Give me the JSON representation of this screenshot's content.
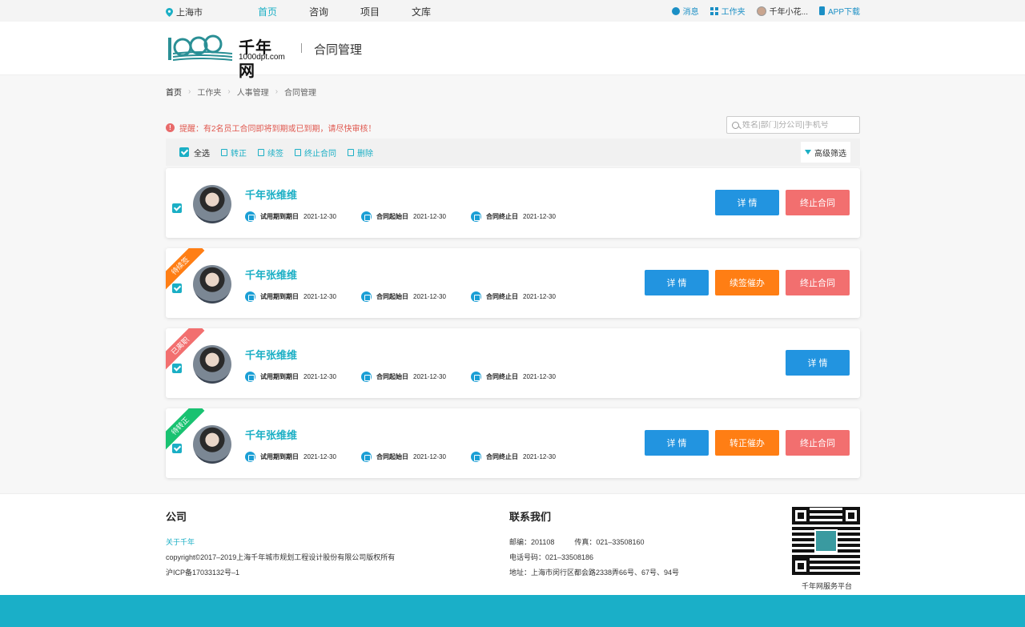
{
  "topbar": {
    "location": "上海市",
    "nav": [
      {
        "label": "首页",
        "active": true
      },
      {
        "label": "咨询",
        "active": false
      },
      {
        "label": "项目",
        "active": false
      },
      {
        "label": "文库",
        "active": false
      }
    ],
    "messages": "消息",
    "workspace": "工作夹",
    "user": "千年小花...",
    "app": "APP下载"
  },
  "header": {
    "brand": "千年网",
    "domain": "1000dpt.com",
    "page_title": "合同管理"
  },
  "breadcrumb": [
    "首页",
    "工作夹",
    "人事管理",
    "合同管理"
  ],
  "notice": "提醒：有2名员工合同即将到期或已到期，请尽快审核！",
  "search": {
    "placeholder": "姓名|部门|分公司|手机号"
  },
  "toolbar": {
    "select_all": "全选",
    "actions": [
      "转正",
      "续签",
      "终止合同",
      "删除"
    ],
    "advanced": "高级筛选"
  },
  "colors": {
    "accent": "#1bafc5",
    "blue": "#2294e0",
    "orange": "#ff7e14",
    "red": "#f26f6f",
    "green": "#19c271"
  },
  "labels": {
    "probation_end": "试用期到期日",
    "contract_start": "合同起始日",
    "contract_end": "合同终止日"
  },
  "cards": [
    {
      "name": "千年张维维",
      "ribbon": "",
      "ribbon_color": "",
      "probation_end": "2021-12-30",
      "contract_start": "2021-12-30",
      "contract_end": "2021-12-30",
      "buttons": [
        {
          "label": "详 情",
          "color": "blue"
        },
        {
          "label": "终止合同",
          "color": "red"
        }
      ]
    },
    {
      "name": "千年张维维",
      "ribbon": "待续签",
      "ribbon_color": "#ff7e14",
      "probation_end": "2021-12-30",
      "contract_start": "2021-12-30",
      "contract_end": "2021-12-30",
      "buttons": [
        {
          "label": "详 情",
          "color": "blue"
        },
        {
          "label": "续签催办",
          "color": "orange"
        },
        {
          "label": "终止合同",
          "color": "red"
        }
      ]
    },
    {
      "name": "千年张维维",
      "ribbon": "已离职",
      "ribbon_color": "#f26f6f",
      "probation_end": "2021-12-30",
      "contract_start": "2021-12-30",
      "contract_end": "2021-12-30",
      "buttons": [
        {
          "label": "详 情",
          "color": "blue"
        }
      ]
    },
    {
      "name": "千年张维维",
      "ribbon": "待转正",
      "ribbon_color": "#19c271",
      "probation_end": "2021-12-30",
      "contract_start": "2021-12-30",
      "contract_end": "2021-12-30",
      "buttons": [
        {
          "label": "详 情",
          "color": "blue"
        },
        {
          "label": "转正催办",
          "color": "orange"
        },
        {
          "label": "终止合同",
          "color": "red"
        }
      ]
    }
  ],
  "footer": {
    "company_title": "公司",
    "about": "关于千年",
    "copyright": "copyright©2017–2019上海千年城市规划工程设计股份有限公司版权所有",
    "icp": "沪ICP备17033132号–1",
    "contact_title": "联系我们",
    "postcode": "邮编：201108",
    "fax": "传真：021–33508160",
    "phone": "电话号码：021–33508186",
    "address": "地址：上海市闵行区都会路2338弄66号、67号、94号",
    "qr_caption": "千年网服务平台"
  }
}
